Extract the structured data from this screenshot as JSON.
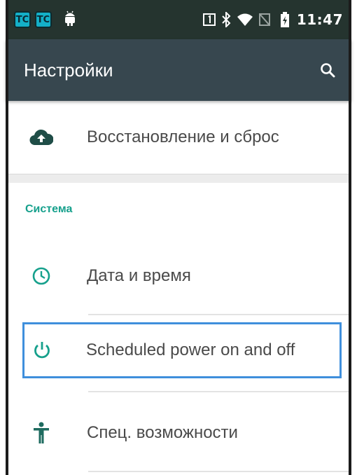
{
  "status_bar": {
    "left_badges": [
      "TC",
      "TC"
    ],
    "time": "11:47",
    "icons": [
      "sim-1-icon",
      "bluetooth-icon",
      "wifi-icon",
      "no-sim-icon",
      "battery-icon"
    ]
  },
  "app_bar": {
    "title": "Настройки",
    "search_icon": "search-icon"
  },
  "items": {
    "restore": {
      "label": "Восстановление и сброс",
      "icon": "cloud-upload-icon"
    },
    "datetime": {
      "label": "Дата и время",
      "icon": "clock-icon"
    },
    "scheduled_power": {
      "label": "Scheduled power on and off",
      "icon": "power-icon"
    },
    "accessibility": {
      "label": "Спец. возможности",
      "icon": "accessibility-icon"
    }
  },
  "section": {
    "system": "Система"
  },
  "colors": {
    "accent": "#16a08c",
    "toolbar": "#37474f",
    "status_bar": "#25342f",
    "highlight": "#3f8fdc"
  }
}
